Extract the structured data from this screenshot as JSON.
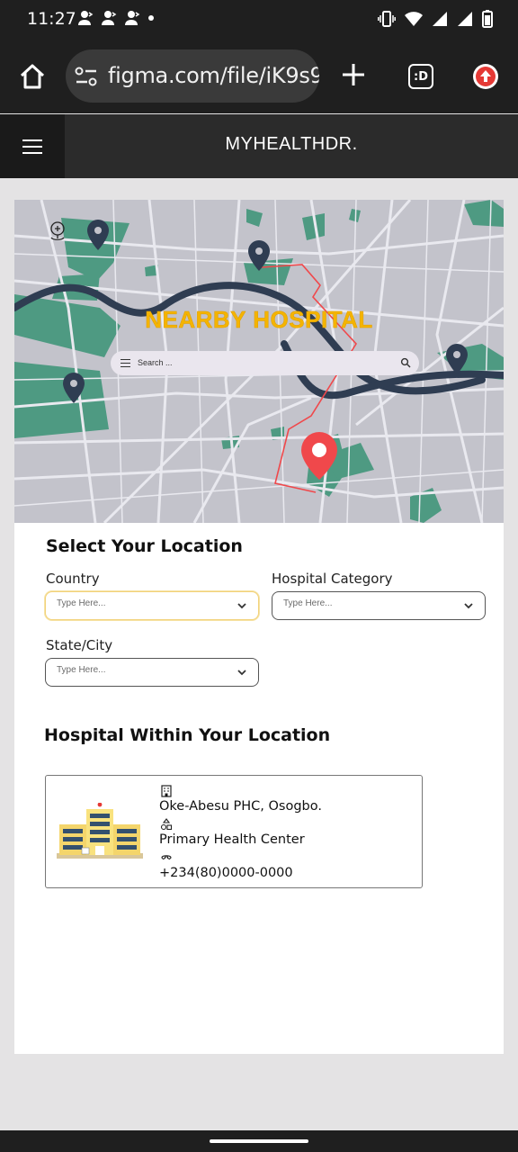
{
  "status_bar": {
    "time": "11:27",
    "left_icons": [
      "contact-icon",
      "contact-icon",
      "contact-icon",
      "dot-icon"
    ],
    "right_icons": [
      "vibrate-icon",
      "wifi-icon",
      "signal-icon",
      "signal-icon",
      "battery-icon"
    ]
  },
  "browser": {
    "url": "figma.com/file/iK9s9",
    "tab_count": ":D"
  },
  "app": {
    "title": "MYHEALTHDR."
  },
  "map": {
    "title": "NEARBY HOSPITAL",
    "search_placeholder": "Search ..."
  },
  "location_form": {
    "title": "Select Your Location",
    "country_label": "Country",
    "country_placeholder": "Type Here...",
    "category_label": "Hospital Category",
    "category_placeholder": "Type Here...",
    "state_label": "State/City",
    "state_placeholder": "Type Here..."
  },
  "hospitals": {
    "title": "Hospital Within Your Location",
    "items": [
      {
        "name": "Oke-Abesu PHC, Osogbo.",
        "category": "Primary Health Center",
        "phone": "+234(80)0000-0000"
      }
    ]
  },
  "colors": {
    "accent": "#f4b400",
    "map_green": "#4e9a82",
    "map_road_dark": "#2f3d52",
    "pin_red": "#f0484b"
  }
}
